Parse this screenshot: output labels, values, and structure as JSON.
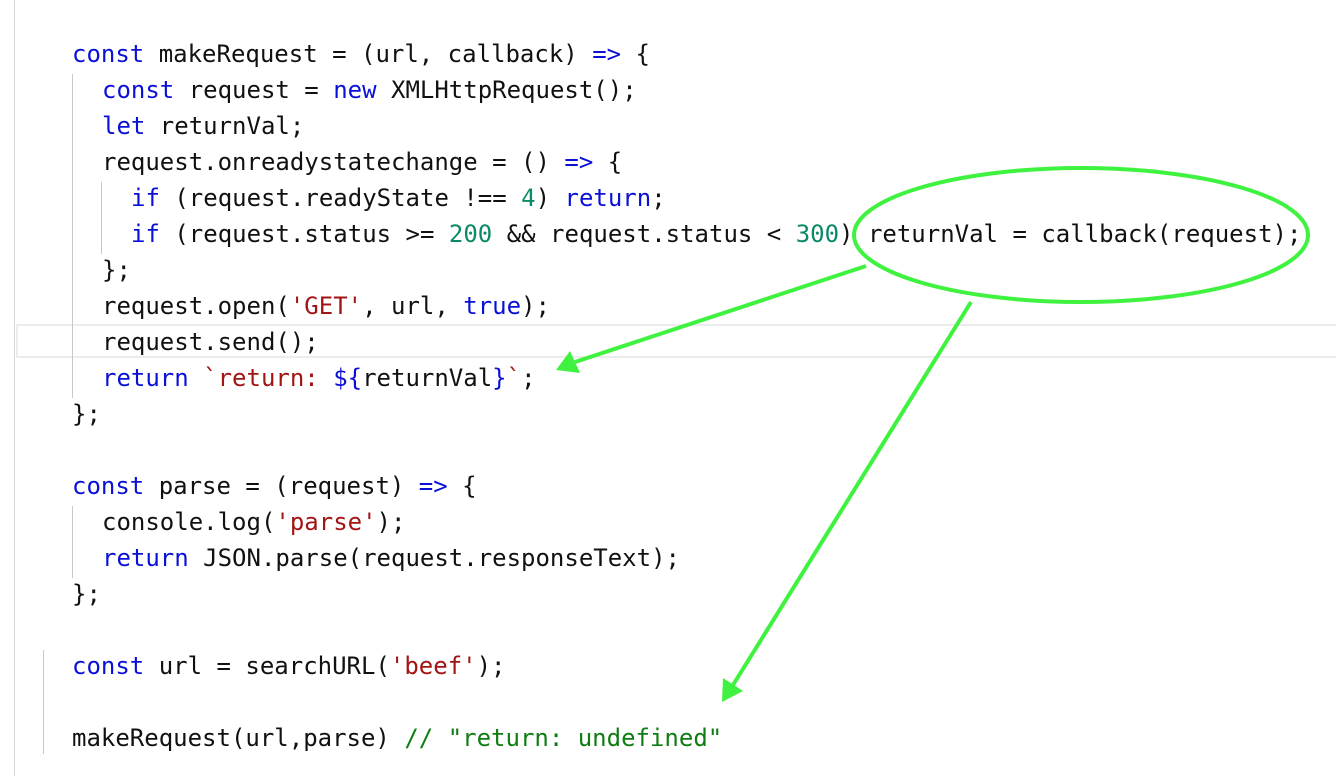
{
  "code_lines": [
    {
      "id": "l1",
      "tokens": [
        {
          "t": "const",
          "c": "kw"
        },
        {
          "t": " makeRequest = (url, callback) "
        },
        {
          "t": "=>",
          "c": "kw"
        },
        {
          "t": " {"
        }
      ]
    },
    {
      "id": "l2",
      "tokens": [
        {
          "t": "const",
          "c": "kw"
        },
        {
          "t": " request = "
        },
        {
          "t": "new",
          "c": "kw"
        },
        {
          "t": " XMLHttpRequest();"
        }
      ]
    },
    {
      "id": "l3",
      "tokens": [
        {
          "t": "let",
          "c": "kw"
        },
        {
          "t": " returnVal;"
        }
      ]
    },
    {
      "id": "l4",
      "tokens": [
        {
          "t": "request.onreadystatechange = () "
        },
        {
          "t": "=>",
          "c": "kw"
        },
        {
          "t": " {"
        }
      ]
    },
    {
      "id": "l5",
      "tokens": [
        {
          "t": "if",
          "c": "kw"
        },
        {
          "t": " (request.readyState !== "
        },
        {
          "t": "4",
          "c": "num"
        },
        {
          "t": ") "
        },
        {
          "t": "return",
          "c": "kw"
        },
        {
          "t": ";"
        }
      ]
    },
    {
      "id": "l6",
      "tokens": [
        {
          "t": "if",
          "c": "kw"
        },
        {
          "t": " (request.status >= "
        },
        {
          "t": "200",
          "c": "num"
        },
        {
          "t": " && request.status < "
        },
        {
          "t": "300",
          "c": "num"
        },
        {
          "t": ") returnVal = callback(request);"
        }
      ]
    },
    {
      "id": "l7",
      "tokens": [
        {
          "t": "};"
        }
      ]
    },
    {
      "id": "l8",
      "tokens": [
        {
          "t": "request.open("
        },
        {
          "t": "'GET'",
          "c": "str"
        },
        {
          "t": ", url, "
        },
        {
          "t": "true",
          "c": "kw"
        },
        {
          "t": ");"
        }
      ]
    },
    {
      "id": "l9",
      "tokens": [
        {
          "t": "request.send();"
        }
      ]
    },
    {
      "id": "l10",
      "tokens": [
        {
          "t": "return",
          "c": "kw"
        },
        {
          "t": " `return: ",
          "c": "str"
        },
        {
          "t": "${",
          "c": "kw"
        },
        {
          "t": "returnVal"
        },
        {
          "t": "}",
          "c": "kw"
        },
        {
          "t": "`",
          "c": "str"
        },
        {
          "t": ";"
        }
      ]
    },
    {
      "id": "l11",
      "tokens": [
        {
          "t": "};"
        }
      ]
    },
    {
      "id": "l12",
      "tokens": [
        {
          "t": "const",
          "c": "kw"
        },
        {
          "t": " parse = (request) "
        },
        {
          "t": "=>",
          "c": "kw"
        },
        {
          "t": " {"
        }
      ]
    },
    {
      "id": "l13",
      "tokens": [
        {
          "t": "console.log("
        },
        {
          "t": "'parse'",
          "c": "str"
        },
        {
          "t": ");"
        }
      ]
    },
    {
      "id": "l14",
      "tokens": [
        {
          "t": "return",
          "c": "kw"
        },
        {
          "t": " JSON.parse(request.responseText);"
        }
      ]
    },
    {
      "id": "l15",
      "tokens": [
        {
          "t": "};"
        }
      ]
    },
    {
      "id": "l16",
      "tokens": [
        {
          "t": "const",
          "c": "kw"
        },
        {
          "t": " url = searchURL("
        },
        {
          "t": "'beef'",
          "c": "str"
        },
        {
          "t": ");"
        }
      ]
    },
    {
      "id": "l17",
      "tokens": [
        {
          "t": "makeRequest(url,parse) "
        },
        {
          "t": "// \"return: undefined\"",
          "c": "cmt"
        }
      ]
    }
  ],
  "annotation": {
    "color": "#3ff23f",
    "highlight_icon": "ellipse-highlight",
    "arrow_icon": "arrow-icon"
  },
  "syntax_colors": {
    "keyword": "#0a10d6",
    "number": "#0b8a6a",
    "string": "#a31515",
    "comment": "#0f7d12",
    "text": "#111111"
  }
}
